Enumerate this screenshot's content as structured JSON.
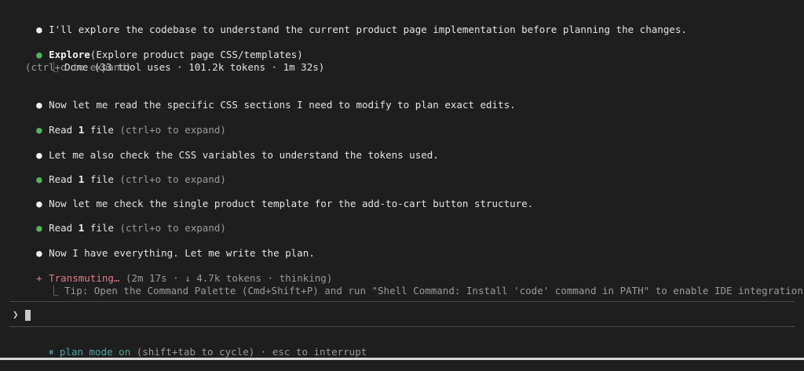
{
  "colors": {
    "background": "#1e1e1e",
    "text": "#e3e3e3",
    "dim": "#9a9a9a",
    "green": "#4fb55d",
    "transmute": "#e07a8a",
    "plan_mode": "#4fa8a0"
  },
  "icons": {
    "white_bullet": "white-dot",
    "green_bullet": "green-dot",
    "transmute_bullet": "pink-asterisk",
    "tree_branch": "corner-branch",
    "prompt_caret": "chevron-right",
    "plan_mode_icon": "pause-bars"
  },
  "glyphs": {
    "dot": "●",
    "asterisk": "+",
    "branch": "⎿",
    "caret": "❯",
    "pause": "⏸"
  },
  "log": {
    "msg1": "I'll explore the codebase to understand the current product page implementation before planning the changes.",
    "explore": {
      "tool": "Explore",
      "args": "(Explore product page CSS/templates)",
      "result": "Done (33 tool uses · 101.2k tokens · 1m 32s)",
      "hint": "(ctrl+o to expand)"
    },
    "msg2": "Now let me read the specific CSS sections I need to modify to plan exact edits.",
    "read1": {
      "tool": "Read",
      "count": "1",
      "unit": "file",
      "hint": "(ctrl+o to expand)"
    },
    "msg3": "Let me also check the CSS variables to understand the tokens used.",
    "read2": {
      "tool": "Read",
      "count": "1",
      "unit": "file",
      "hint": "(ctrl+o to expand)"
    },
    "msg4": "Now let me check the single product template for the add-to-cart button structure.",
    "read3": {
      "tool": "Read",
      "count": "1",
      "unit": "file",
      "hint": "(ctrl+o to expand)"
    },
    "msg5": "Now I have everything. Let me write the plan.",
    "status": {
      "label": "Transmuting…",
      "details": "(2m 17s · ↓ 4.7k tokens · thinking)",
      "tip": "Tip: Open the Command Palette (Cmd+Shift+P) and run \"Shell Command: Install 'code' command in PATH\" to enable IDE integration"
    }
  },
  "footer": {
    "mode": "plan mode on",
    "hint": "(shift+tab to cycle) · esc to interrupt"
  }
}
